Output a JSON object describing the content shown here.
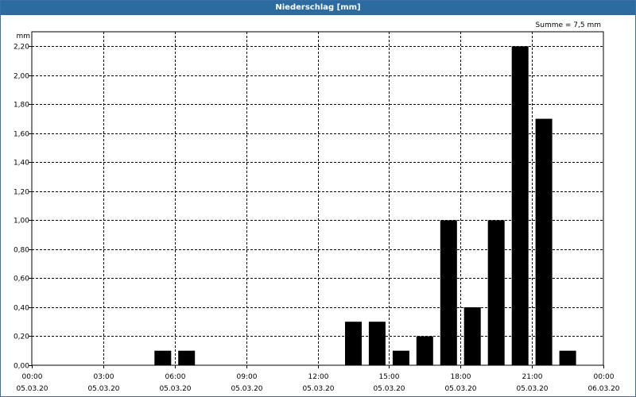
{
  "window": {
    "title": "Niederschlag [mm]"
  },
  "summary": {
    "label": "Summe = 7,5 mm"
  },
  "colors": {
    "titlebar": "#2c6ba0",
    "bar": "#000000",
    "grid": "#000000"
  },
  "chart_data": {
    "type": "bar",
    "title": "",
    "ylabel": "mm",
    "xlabel": "",
    "grid": true,
    "xlim_hours": [
      0,
      24
    ],
    "ylim": [
      0,
      2.3
    ],
    "yticks": [
      0,
      0.2,
      0.4,
      0.6,
      0.8,
      1.0,
      1.2,
      1.4,
      1.6,
      1.8,
      2.0,
      2.2
    ],
    "ytick_labels": [
      "0,00",
      "0,20",
      "0,40",
      "0,60",
      "0,80",
      "1,00",
      "1,20",
      "1,40",
      "1,60",
      "1,80",
      "2,00",
      "2,20"
    ],
    "xticks": [
      {
        "hour": 0,
        "time": "00:00",
        "date": "05.03.20"
      },
      {
        "hour": 3,
        "time": "03:00",
        "date": "05.03.20"
      },
      {
        "hour": 6,
        "time": "06:00",
        "date": "05.03.20"
      },
      {
        "hour": 9,
        "time": "09:00",
        "date": "05.03.20"
      },
      {
        "hour": 12,
        "time": "12:00",
        "date": "05.03.20"
      },
      {
        "hour": 15,
        "time": "15:00",
        "date": "05.03.20"
      },
      {
        "hour": 18,
        "time": "18:00",
        "date": "05.03.20"
      },
      {
        "hour": 21,
        "time": "21:00",
        "date": "05.03.20"
      },
      {
        "hour": 24,
        "time": "00:00",
        "date": "06.03.20"
      }
    ],
    "bars": [
      {
        "hour": 5.5,
        "value": 0.1
      },
      {
        "hour": 6.5,
        "value": 0.1
      },
      {
        "hour": 13.5,
        "value": 0.3
      },
      {
        "hour": 14.5,
        "value": 0.3
      },
      {
        "hour": 15.5,
        "value": 0.1
      },
      {
        "hour": 16.5,
        "value": 0.2
      },
      {
        "hour": 17.5,
        "value": 1.0
      },
      {
        "hour": 18.5,
        "value": 0.4
      },
      {
        "hour": 19.5,
        "value": 1.0
      },
      {
        "hour": 20.5,
        "value": 2.2
      },
      {
        "hour": 21.5,
        "value": 1.7
      },
      {
        "hour": 22.5,
        "value": 0.1
      }
    ]
  }
}
